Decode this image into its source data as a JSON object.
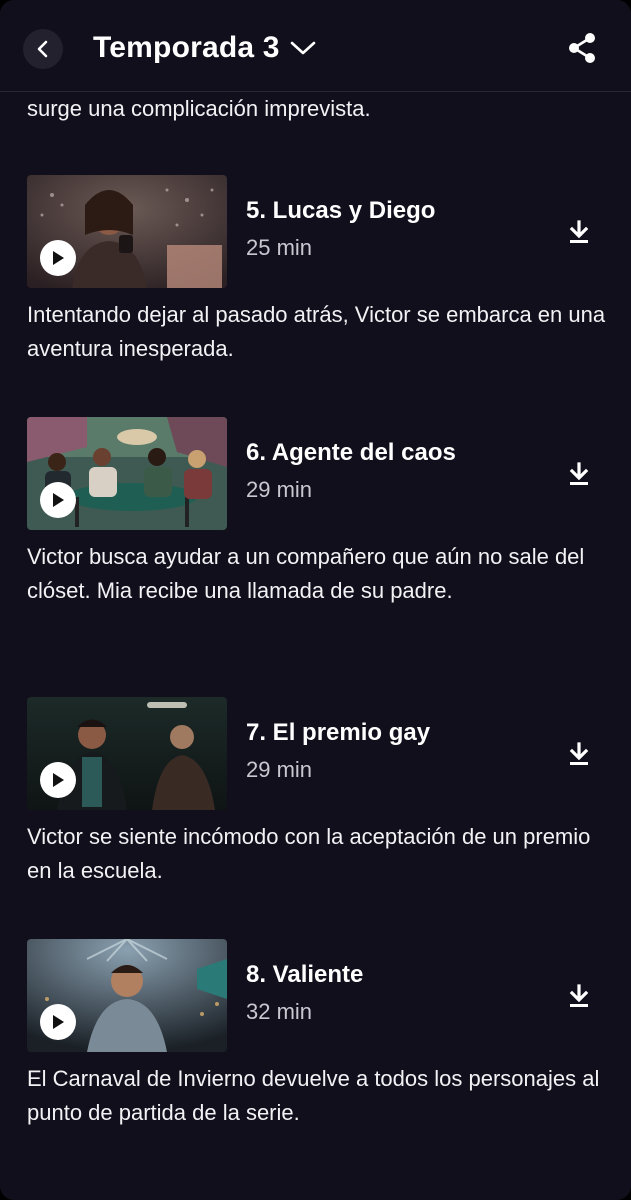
{
  "header": {
    "back_icon": "chevron-left-icon",
    "season_label": "Temporada 3",
    "dropdown_icon": "chevron-down-icon",
    "share_icon": "share-icon"
  },
  "previous_description": "surge una complicación imprevista.",
  "episodes": [
    {
      "title": "5. Lucas y Diego",
      "duration": "25 min",
      "description": "Intentando dejar al pasado atrás, Victor se embarca en una aventura inesperada.",
      "play_icon": "play-icon",
      "download_icon": "download-icon"
    },
    {
      "title": "6. Agente del caos",
      "duration": "29 min",
      "description": "Victor busca ayudar a un compañero que aún no sale del clóset. Mia recibe una llamada de su padre.",
      "play_icon": "play-icon",
      "download_icon": "download-icon"
    },
    {
      "title": "7. El premio gay",
      "duration": "29 min",
      "description": "Victor se siente incómodo con la aceptación de un premio en la escuela.",
      "play_icon": "play-icon",
      "download_icon": "download-icon"
    },
    {
      "title": "8. Valiente",
      "duration": "32 min",
      "description": "El Carnaval de Invierno devuelve a todos los personajes al punto de partida de la serie.",
      "play_icon": "play-icon",
      "download_icon": "download-icon"
    }
  ],
  "colors": {
    "background": "#110f1b",
    "text": "#ffffff",
    "muted_text": "#c9c8d0"
  }
}
